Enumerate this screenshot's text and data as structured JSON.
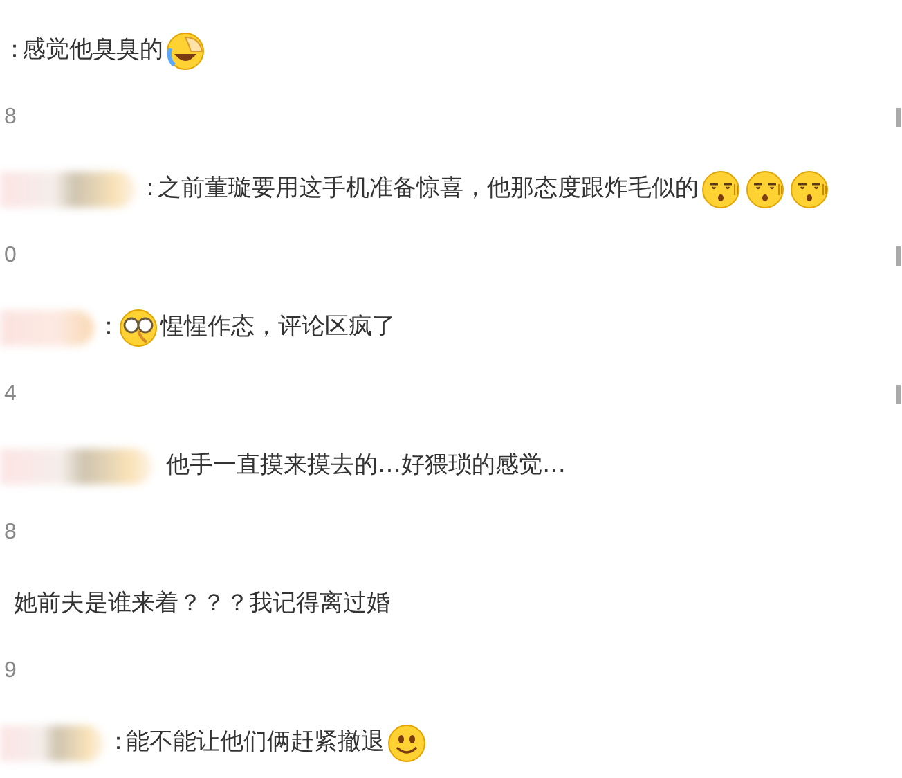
{
  "comments": [
    {
      "colon": "：",
      "text": "感觉他臭臭的",
      "emoji_after": [
        {
          "kind": "facepalm"
        }
      ],
      "time": "8",
      "edge_icon": true
    },
    {
      "username": {
        "kind": "blurred"
      },
      "colon": "：",
      "text": "之前董璇要用这手机准备惊喜，他那态度跟炸毛似的",
      "emoji_after": [
        {
          "kind": "sideeye"
        },
        {
          "kind": "sideeye"
        },
        {
          "kind": "sideeye"
        }
      ],
      "time": "0",
      "edge_icon": true
    },
    {
      "username": {
        "kind": "blurred"
      },
      "colon": "：",
      "text": "惺惺作态，评论区疯了",
      "emoji_before": [
        {
          "kind": "glasses"
        }
      ],
      "time": "4",
      "edge_icon": true
    },
    {
      "username": {
        "kind": "blurred"
      },
      "text": "他手一直摸来摸去的…好猥琐的感觉…",
      "time": "8",
      "edge_icon": false
    },
    {
      "text": "她前夫是谁来着？？？我记得离过婚",
      "time": "9",
      "edge_icon": false
    },
    {
      "username": {
        "kind": "blurred"
      },
      "colon": "：",
      "text": "能不能让他们俩赶紧撤退",
      "emoji_after": [
        {
          "kind": "smile"
        }
      ]
    }
  ]
}
